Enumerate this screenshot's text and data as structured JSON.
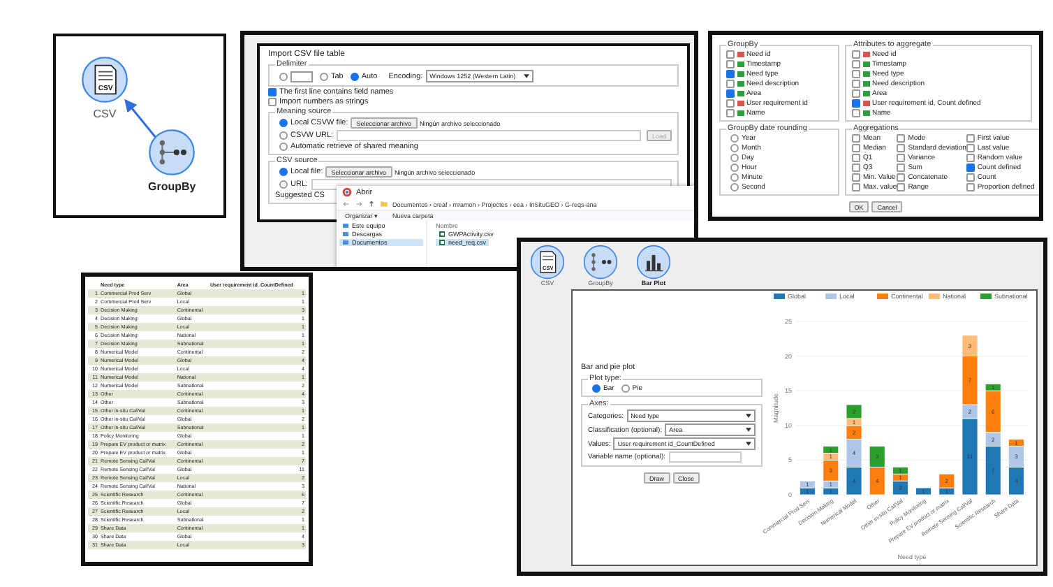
{
  "diagram": {
    "nodes": [
      {
        "kind": "csv",
        "label": "CSV",
        "icon_text": "CSV",
        "selected": false
      },
      {
        "kind": "groupby",
        "label": "GroupBy",
        "selected": true
      }
    ]
  },
  "csv_import": {
    "title": "Import CSV file table",
    "delimiter": {
      "legend": "Delimiter",
      "options": [
        {
          "kind": "custom",
          "selected": false
        },
        {
          "kind": "plain",
          "label": "Tab",
          "selected": false
        },
        {
          "kind": "plain",
          "label": "Auto",
          "selected": true
        }
      ],
      "encoding_label": "Encoding:",
      "encoding_value": "Windows 1252 (Western Latin)"
    },
    "checks": [
      {
        "label": "The first line contains field names",
        "checked": true
      },
      {
        "label": "Import numbers as strings",
        "checked": false
      }
    ],
    "meaning": {
      "legend": "Meaning source",
      "options": [
        {
          "kind": "file",
          "label": "Local CSVW file:",
          "selected": true,
          "button": "Seleccionar archivo",
          "status": "Ningún archivo seleccionado"
        },
        {
          "kind": "url",
          "label": "CSVW URL:",
          "selected": false,
          "button": "Load"
        },
        {
          "kind": "plain",
          "label": "Automatic retrieve of shared meaning",
          "selected": false
        }
      ]
    },
    "source": {
      "legend": "CSV source",
      "options": [
        {
          "kind": "file",
          "label": "Local file:",
          "selected": true,
          "button": "Seleccionar archivo",
          "status": "Ningún archivo seleccionado"
        },
        {
          "kind": "url",
          "label": "URL:",
          "selected": false
        }
      ],
      "suggested": "Suggested CS"
    }
  },
  "file_dialog": {
    "title": "Abrir",
    "path": "Documentos  ›  creaf  ›  mramon  ›  Projectes  ›  eea  ›  InSituGEO  ›  G-reqs-ana",
    "toolbar": [
      "Organizar ▾",
      "Nueva carpeta"
    ],
    "nav": [
      {
        "label": "Este equipo",
        "selected": false
      },
      {
        "label": "Descargas",
        "selected": false
      },
      {
        "label": "Documentos",
        "selected": true
      }
    ],
    "column": "Nombre",
    "files": [
      {
        "name": "GWPActivity.csv",
        "selected": false
      },
      {
        "name": "need_req.csv",
        "selected": true
      }
    ]
  },
  "groupby_dialog": {
    "groupby": {
      "legend": "GroupBy",
      "fields": [
        {
          "name": "Need id",
          "kind": "number",
          "checked": false
        },
        {
          "name": "Timestamp",
          "kind": "text",
          "checked": false
        },
        {
          "name": "Need type",
          "kind": "text",
          "checked": true
        },
        {
          "name": "Need description",
          "kind": "text",
          "checked": false
        },
        {
          "name": "Area",
          "kind": "text",
          "checked": true
        },
        {
          "name": "User requirement id",
          "kind": "number",
          "checked": false
        },
        {
          "name": "Name",
          "kind": "text",
          "checked": false
        }
      ]
    },
    "attributes": {
      "legend": "Attributes to aggregate",
      "fields": [
        {
          "name": "Need id",
          "kind": "number",
          "checked": false
        },
        {
          "name": "Timestamp",
          "kind": "text",
          "checked": false
        },
        {
          "name": "Need type",
          "kind": "text",
          "checked": false
        },
        {
          "name": "Need description",
          "kind": "text",
          "checked": false
        },
        {
          "name": "Area",
          "kind": "text",
          "checked": false
        },
        {
          "name": "User requirement id, Count defined",
          "kind": "number",
          "checked": true
        },
        {
          "name": "Name",
          "kind": "text",
          "checked": false
        }
      ]
    },
    "rounding": {
      "legend": "GroupBy date rounding",
      "options": [
        {
          "label": "Year",
          "selected": false
        },
        {
          "label": "Month",
          "selected": false
        },
        {
          "label": "Day",
          "selected": false
        },
        {
          "label": "Hour",
          "selected": false
        },
        {
          "label": "Minute",
          "selected": false
        },
        {
          "label": "Second",
          "selected": false
        }
      ]
    },
    "aggregations": {
      "legend": "Aggregations",
      "options": [
        {
          "label": "Mean",
          "checked": false
        },
        {
          "label": "Mode",
          "checked": false
        },
        {
          "label": "First value",
          "checked": false
        },
        {
          "label": "Median",
          "checked": false
        },
        {
          "label": "Standard deviation",
          "checked": false
        },
        {
          "label": "Last value",
          "checked": false
        },
        {
          "label": "Q1",
          "checked": false
        },
        {
          "label": "Variance",
          "checked": false
        },
        {
          "label": "Random value",
          "checked": false
        },
        {
          "label": "Q3",
          "checked": false
        },
        {
          "label": "Sum",
          "checked": false
        },
        {
          "label": "Count defined",
          "checked": true
        },
        {
          "label": "Min. Value",
          "checked": false
        },
        {
          "label": "Concatenate",
          "checked": false
        },
        {
          "label": "Count",
          "checked": false
        },
        {
          "label": "Max. value",
          "checked": false
        },
        {
          "label": "Range",
          "checked": false
        },
        {
          "label": "Proportion defined",
          "checked": false
        }
      ]
    },
    "buttons": [
      "OK",
      "Cancel"
    ]
  },
  "table": {
    "columns": [
      "",
      "Need type",
      "Area",
      "User requirement id_CountDefined"
    ],
    "rows": [
      [
        "1",
        "Commercial Prod Serv",
        "Global",
        "1"
      ],
      [
        "2",
        "Commercial Prod Serv",
        "Local",
        "1"
      ],
      [
        "3",
        "Decision Making",
        "Continental",
        "3"
      ],
      [
        "4",
        "Decision Making",
        "Global",
        "1"
      ],
      [
        "5",
        "Decision Making",
        "Local",
        "1"
      ],
      [
        "6",
        "Decision Making",
        "National",
        "1"
      ],
      [
        "7",
        "Decision Making",
        "Subnational",
        "1"
      ],
      [
        "8",
        "Numerical Model",
        "Continental",
        "2"
      ],
      [
        "9",
        "Numerical Model",
        "Global",
        "4"
      ],
      [
        "10",
        "Numerical Model",
        "Local",
        "4"
      ],
      [
        "11",
        "Numerical Model",
        "National",
        "1"
      ],
      [
        "12",
        "Numerical Model",
        "Subnational",
        "2"
      ],
      [
        "13",
        "Other",
        "Continental",
        "4"
      ],
      [
        "14",
        "Other",
        "Subnational",
        "3"
      ],
      [
        "15",
        "Other in-situ Cal/Val",
        "Continental",
        "1"
      ],
      [
        "16",
        "Other in-situ Cal/Val",
        "Global",
        "2"
      ],
      [
        "17",
        "Other in-situ Cal/Val",
        "Subnational",
        "1"
      ],
      [
        "18",
        "Policy Monitoring",
        "Global",
        "1"
      ],
      [
        "19",
        "Prepare EV product or matrix",
        "Continental",
        "2"
      ],
      [
        "20",
        "Prepare EV product or matrix",
        "Global",
        "1"
      ],
      [
        "21",
        "Remote Sensing Cal/Val",
        "Continental",
        "7"
      ],
      [
        "22",
        "Remote Sensing Cal/Val",
        "Global",
        "11"
      ],
      [
        "23",
        "Remote Sensing Cal/Val",
        "Local",
        "2"
      ],
      [
        "24",
        "Remote Sensing Cal/Val",
        "National",
        "3"
      ],
      [
        "25",
        "Scientific Research",
        "Continental",
        "6"
      ],
      [
        "26",
        "Scientific Research",
        "Global",
        "7"
      ],
      [
        "27",
        "Scientific Research",
        "Local",
        "2"
      ],
      [
        "28",
        "Scientific Research",
        "Subnational",
        "1"
      ],
      [
        "29",
        "Share Data",
        "Continental",
        "1"
      ],
      [
        "30",
        "Share Data",
        "Global",
        "4"
      ],
      [
        "31",
        "Share Data",
        "Local",
        "3"
      ]
    ]
  },
  "bar_plot": {
    "nodes": [
      {
        "kind": "csv",
        "label": "CSV",
        "icon_text": "CSV",
        "selected": false
      },
      {
        "kind": "groupby",
        "label": "GroupBy",
        "selected": false
      },
      {
        "kind": "barplot",
        "label": "Bar Plot",
        "selected": true
      }
    ],
    "title": "Bar and pie plot",
    "plot_type": {
      "legend": "Plot type:",
      "options": [
        {
          "label": "Bar",
          "selected": true
        },
        {
          "label": "Pie",
          "selected": false
        }
      ]
    },
    "axes": {
      "legend": "Axes:",
      "fields": [
        {
          "kind": "select",
          "label": "Categories:",
          "value": "Need type"
        },
        {
          "kind": "select",
          "label": "Classification (optional):",
          "value": "Area"
        },
        {
          "kind": "select",
          "label": "Values:",
          "value": "User requirement id_CountDefined"
        },
        {
          "kind": "input",
          "label": "Variable name (optional):"
        }
      ]
    },
    "buttons": [
      "Draw",
      "Close"
    ],
    "chart_data": {
      "type": "bar",
      "stacked": true,
      "grid": true,
      "legend": true,
      "xlabel": "Need type",
      "ylabel": "Magnitude",
      "data_labels": true,
      "categories": [
        "Commercial Prod Serv",
        "Decision Making",
        "Numerical Model",
        "Other",
        "Other in-situ Cal/Val",
        "Policy Monitoring",
        "Prepare EV product or matrix",
        "Remote Sensing Cal/Val",
        "Scientific Research",
        "Share Data"
      ],
      "series": [
        {
          "name": "Global",
          "color": "#1f77b4",
          "values": [
            1,
            1,
            4,
            null,
            2,
            1,
            1,
            11,
            7,
            4
          ]
        },
        {
          "name": "Local",
          "color": "#aec7e8",
          "values": [
            1,
            1,
            4,
            null,
            null,
            null,
            null,
            2,
            2,
            3
          ]
        },
        {
          "name": "Continental",
          "color": "#ff7f0e",
          "values": [
            null,
            3,
            2,
            4,
            1,
            null,
            2,
            7,
            6,
            1
          ]
        },
        {
          "name": "National",
          "color": "#ffbb78",
          "values": [
            null,
            1,
            1,
            null,
            null,
            null,
            null,
            3,
            null,
            null
          ]
        },
        {
          "name": "Subnational",
          "color": "#2ca02c",
          "values": [
            null,
            1,
            2,
            3,
            1,
            null,
            null,
            null,
            1,
            null
          ]
        }
      ],
      "ylim": [
        0,
        25
      ],
      "yticks": [
        0,
        5,
        10,
        15,
        20,
        25
      ]
    }
  }
}
